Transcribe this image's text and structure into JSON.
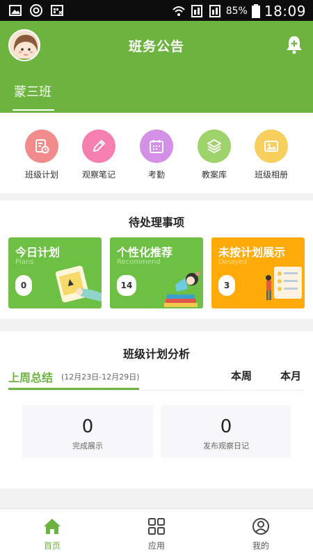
{
  "status_bar": {
    "battery_percent": "85%",
    "time": "18:09",
    "icons": [
      "gallery-icon",
      "sync-icon",
      "calendar-grid-icon",
      "wifi-icon",
      "sim1-icon",
      "sim2-icon",
      "battery-icon"
    ]
  },
  "header": {
    "title": "班务公告",
    "class_tab": "蒙三班",
    "icons": [
      "avatar",
      "bell-add-icon"
    ]
  },
  "shortcuts": [
    {
      "label": "班级计划",
      "icon": "plan-icon",
      "color": "#f28b8b"
    },
    {
      "label": "观察笔记",
      "icon": "pencil-icon",
      "color": "#f57fb1"
    },
    {
      "label": "考勤",
      "icon": "calendar-icon",
      "color": "#d48fe6"
    },
    {
      "label": "教案库",
      "icon": "layers-icon",
      "color": "#9ed26b"
    },
    {
      "label": "班级相册",
      "icon": "photo-icon",
      "color": "#f6cf5e"
    }
  ],
  "pending": {
    "title": "待处理事项",
    "cards": [
      {
        "title": "今日计划",
        "subtitle": "Plans",
        "count": "0",
        "color": "#6ec045"
      },
      {
        "title": "个性化推荐",
        "subtitle": "Recommend",
        "count": "14",
        "color": "#6ec045"
      },
      {
        "title": "未按计划展示",
        "subtitle": "Delayed",
        "count": "3",
        "color": "#ffab0a"
      }
    ]
  },
  "analysis": {
    "title": "班级计划分析",
    "tab_last_week": "上周总结",
    "date_range": "(12月23日-12月29日)",
    "tab_this_week": "本周",
    "tab_this_month": "本月",
    "stats": [
      {
        "value": "0",
        "label": "完成展示"
      },
      {
        "value": "0",
        "label": "发布观察日记"
      }
    ]
  },
  "bottom_nav": [
    {
      "label": "首页",
      "icon": "home-icon",
      "active": true
    },
    {
      "label": "应用",
      "icon": "apps-grid-icon",
      "active": false
    },
    {
      "label": "我的",
      "icon": "profile-icon",
      "active": false
    }
  ],
  "colors": {
    "brand_green": "#6db33f",
    "warning_orange": "#ffab0a"
  }
}
